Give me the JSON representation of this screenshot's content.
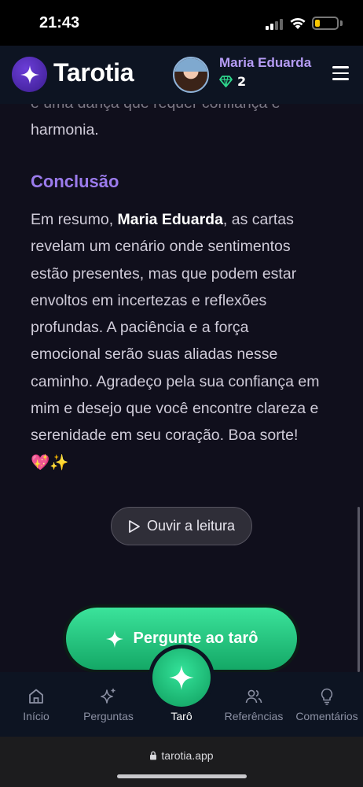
{
  "status_bar": {
    "time": "21:43"
  },
  "header": {
    "app_name": "Tarotia",
    "user_name": "Maria Eduarda",
    "gem_count": "2"
  },
  "content": {
    "cut_line": "e uma dança que requer confiança e",
    "previous_end": "harmonia.",
    "section_title": "Conclusão",
    "paragraph_before_name": "Em resumo, ",
    "paragraph_name": "Maria Eduarda",
    "paragraph_after_name": ", as cartas revelam um cenário onde sentimentos estão presentes, mas que podem estar envoltos em incertezas e reflexões profundas. A paciência e a força emocional serão suas aliadas nesse caminho. Agradeço pela sua confiança em mim e desejo que você encontre clareza e serenidade em seu coração. Boa sorte! 💖✨",
    "listen_button": "Ouvir a leitura",
    "cta_button": "Pergunte ao tarô"
  },
  "bottom_nav": {
    "items": [
      {
        "label": "Início",
        "icon": "home-icon"
      },
      {
        "label": "Perguntas",
        "icon": "sparkles-icon"
      },
      {
        "label": "Tarô",
        "icon": "star-icon"
      },
      {
        "label": "Referências",
        "icon": "users-icon"
      },
      {
        "label": "Comentários",
        "icon": "lightbulb-icon"
      }
    ]
  },
  "browser": {
    "url": "tarotia.app"
  },
  "colors": {
    "accent_purple": "#9b7bec",
    "cta_green": "#2bd487",
    "header_bg": "#0d1422",
    "content_bg": "#100f1c"
  }
}
